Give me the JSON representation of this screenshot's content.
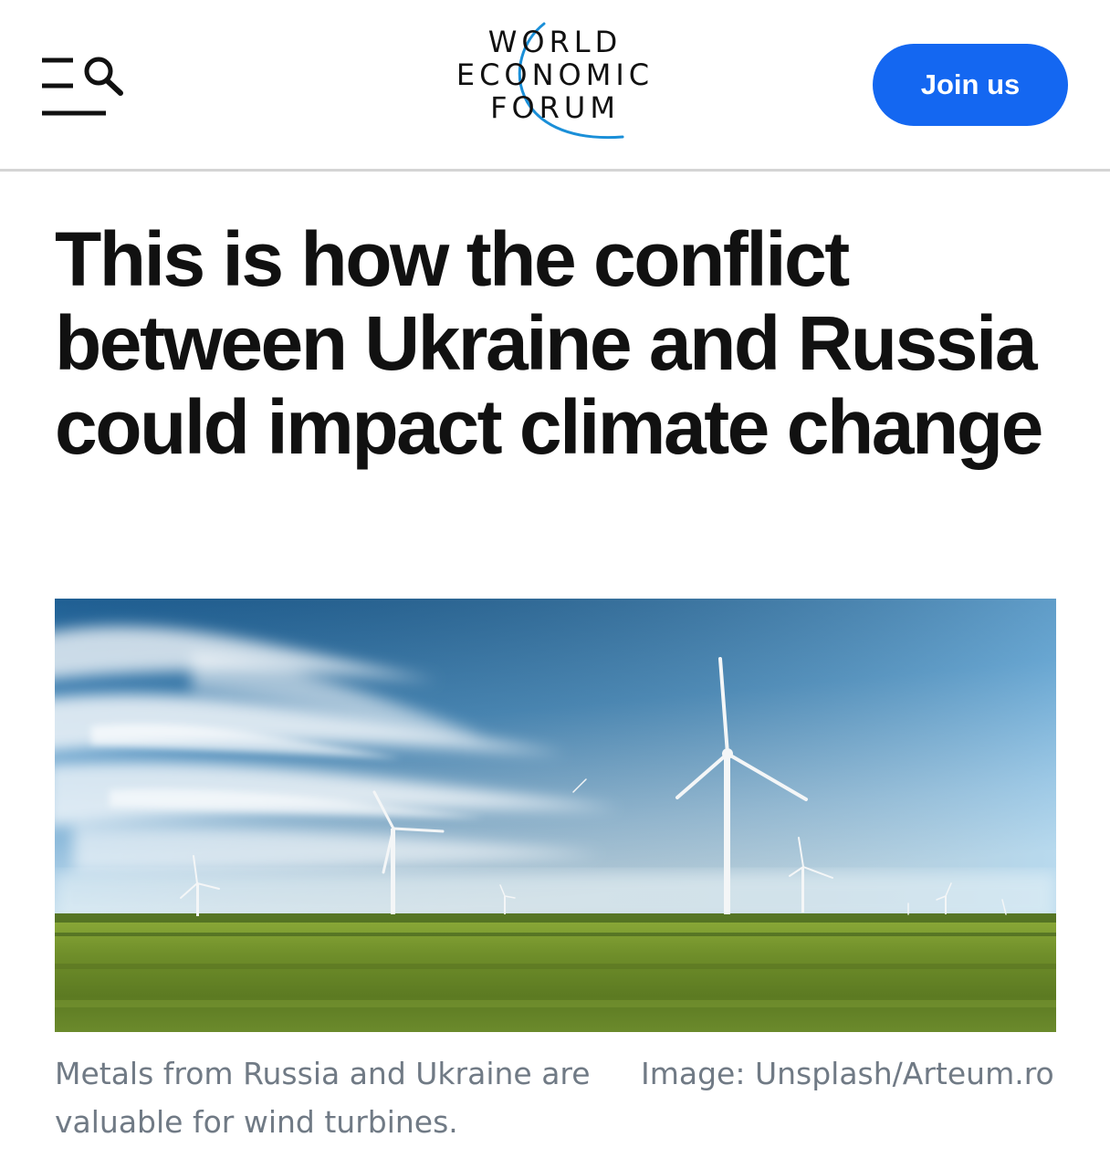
{
  "header": {
    "logo": {
      "line1": "WORLD",
      "line2": "ECONOMIC",
      "line3": "FORUM"
    },
    "menu_icon": "menu-search-icon",
    "join_label": "Join us",
    "join_color": "#1467f1",
    "logo_arc_color": "#1a8fd8"
  },
  "article": {
    "headline": "This is how the conflict between Ukraine and Russia could impact climate change",
    "image_alt": "Wind turbines on a green field under a blue sky",
    "caption": "Metals from Russia and Ukraine are valuable for wind turbines.",
    "credit": "Image: Unsplash/Arteum.ro"
  }
}
